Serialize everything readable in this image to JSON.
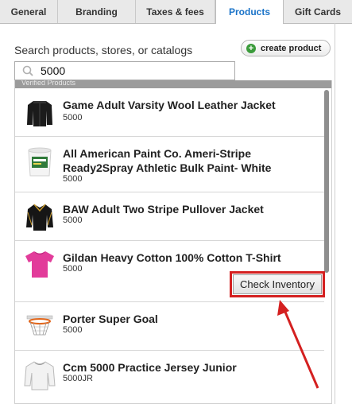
{
  "tabs": [
    {
      "label": "General"
    },
    {
      "label": "Branding"
    },
    {
      "label": "Taxes & fees"
    },
    {
      "label": "Products",
      "active": true
    },
    {
      "label": "Gift Cards"
    }
  ],
  "search": {
    "label": "Search products, stores, or catalogs",
    "value": "5000",
    "icon": "search-icon"
  },
  "create_button": {
    "label": "create product",
    "icon": "plus-circle-icon",
    "icon_color": "#3b9b3b"
  },
  "results": {
    "header": "Verified Products",
    "items": [
      {
        "name": "Game Adult Varsity Wool Leather Jacket",
        "sku": "5000",
        "thumb": "black-jacket"
      },
      {
        "name": "All American Paint Co. Ameri-Stripe Ready2Spray Athletic Bulk Paint- White",
        "sku": "5000",
        "thumb": "paint-bucket"
      },
      {
        "name": "BAW Adult Two Stripe Pullover Jacket",
        "sku": "5000",
        "thumb": "pullover-jacket"
      },
      {
        "name": "Gildan Heavy Cotton 100% Cotton T-Shirt",
        "sku": "5000",
        "thumb": "pink-tshirt",
        "action": "Check Inventory"
      },
      {
        "name": "Porter Super Goal",
        "sku": "5000",
        "thumb": "basketball-hoop"
      },
      {
        "name": "Ccm 5000 Practice Jersey Junior",
        "sku": "5000JR",
        "thumb": "white-jersey"
      }
    ]
  },
  "annotation": {
    "highlight_color": "#d42020"
  }
}
